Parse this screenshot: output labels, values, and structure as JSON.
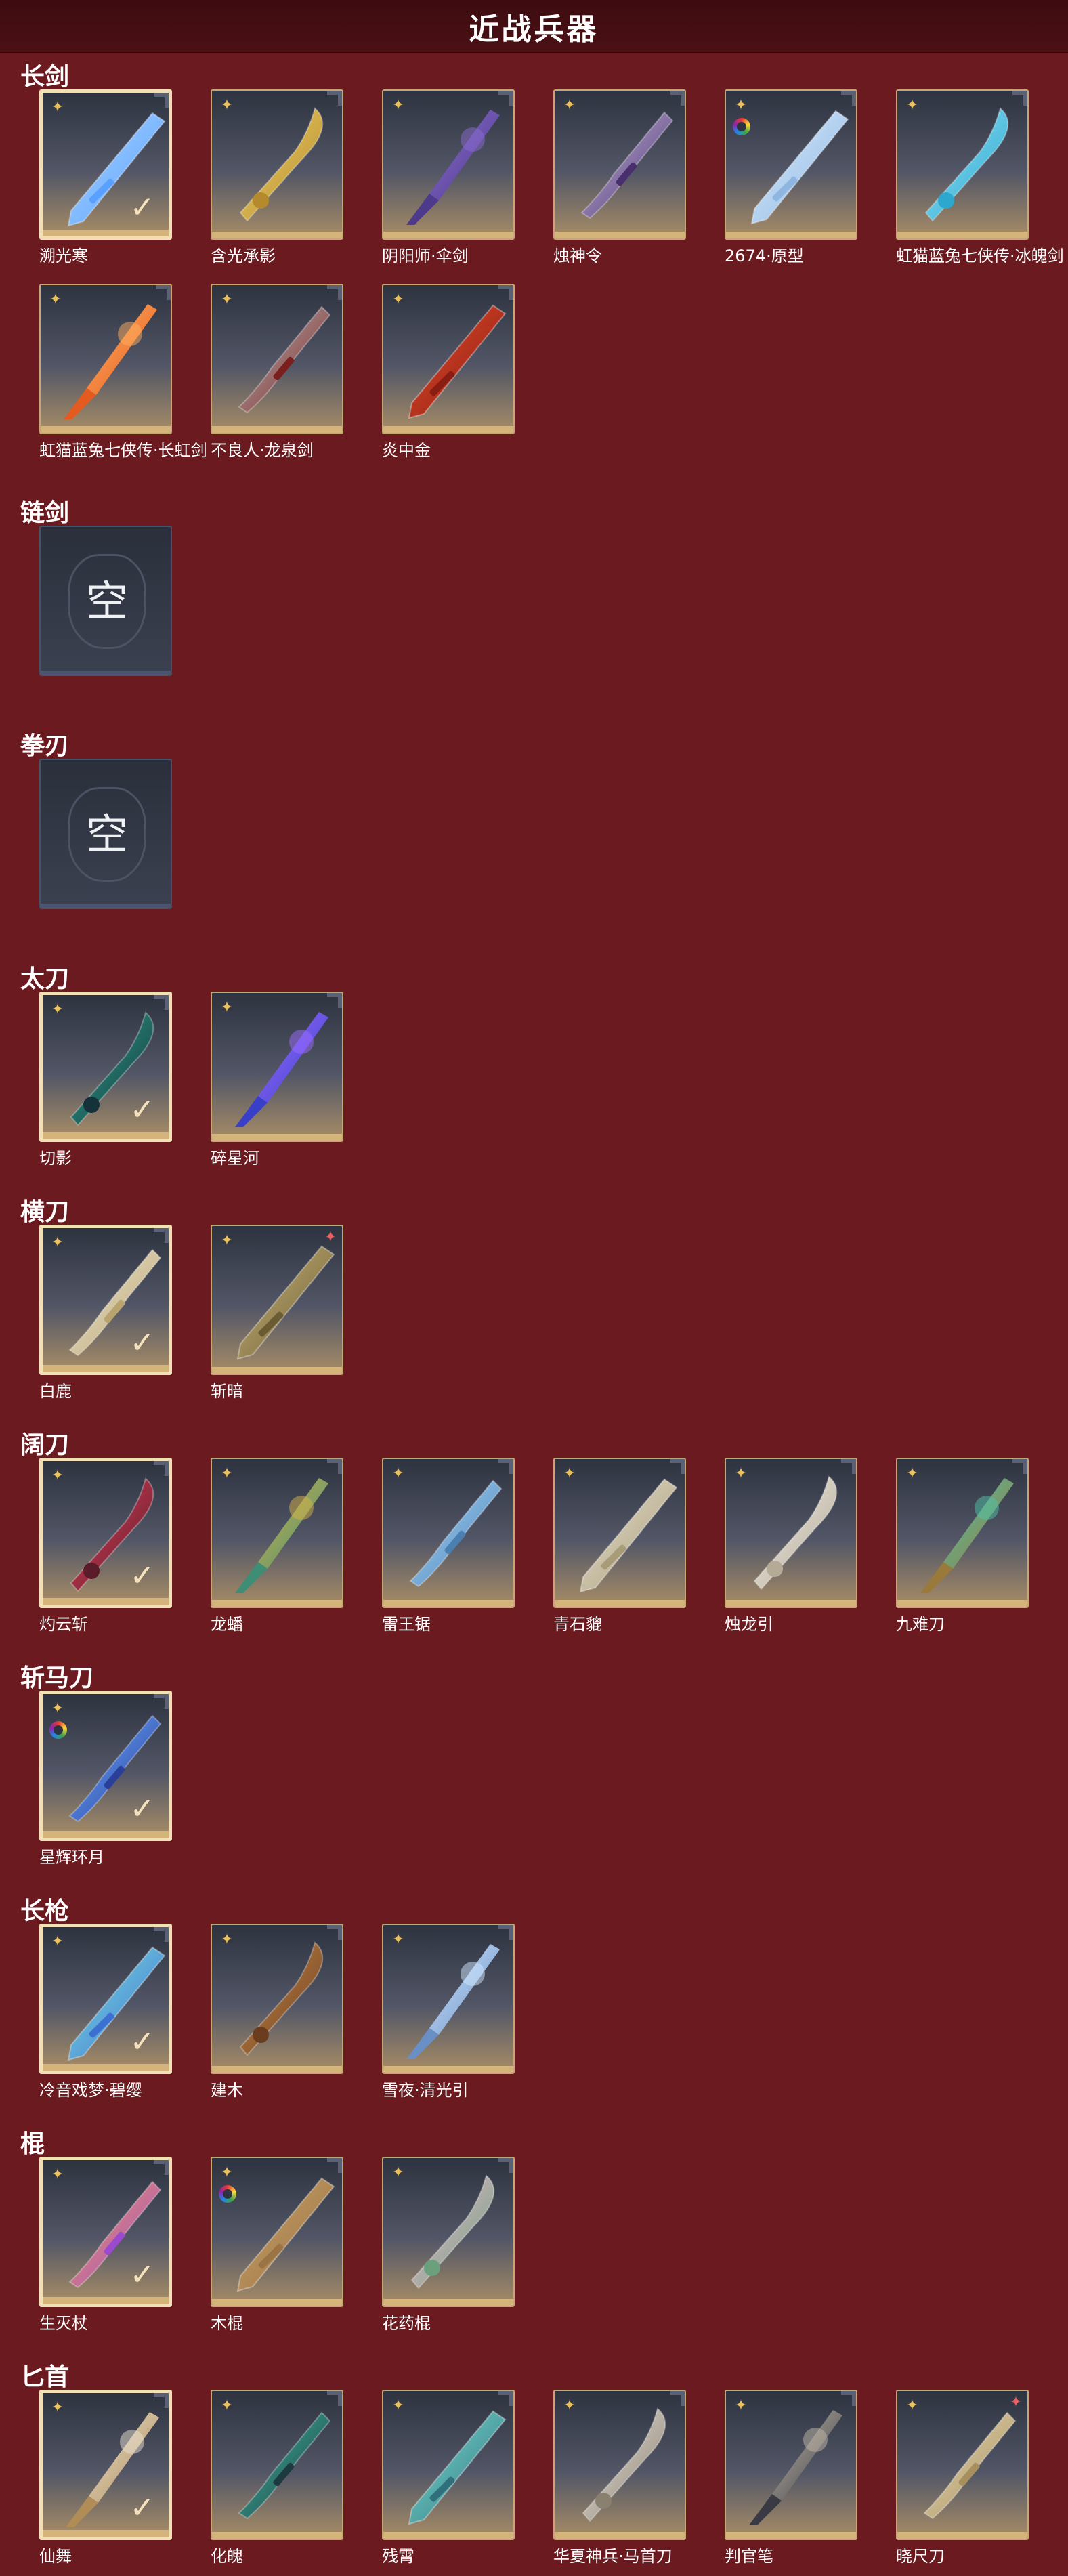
{
  "header": {
    "title": "近战兵器"
  },
  "colors": {
    "background": "#6b1a1f",
    "header": "#3d0c10",
    "tile_border": "#c7a675",
    "selected_border": "#f2dfb6",
    "rank_icon": "#e9c05c"
  },
  "sections": [
    {
      "title": "长剑",
      "items": [
        {
          "name": "溯光寒",
          "selected": true,
          "ring": false,
          "badge": false,
          "colors": [
            "#a8d4ff",
            "#5aa0ff"
          ]
        },
        {
          "name": "含光承影",
          "selected": false,
          "ring": false,
          "badge": false,
          "colors": [
            "#f0d26a",
            "#b48a2c"
          ]
        },
        {
          "name": "阴阳师·伞剑",
          "selected": false,
          "ring": false,
          "badge": false,
          "colors": [
            "#8a6ccf",
            "#4d3a8a"
          ]
        },
        {
          "name": "烛神令",
          "selected": false,
          "ring": false,
          "badge": false,
          "colors": [
            "#c4b8dc",
            "#4a2f6e"
          ]
        },
        {
          "name": "2674·原型",
          "selected": false,
          "ring": true,
          "badge": false,
          "colors": [
            "#d8ecff",
            "#8fb6e0"
          ]
        },
        {
          "name": "虹猫蓝兔七侠传·冰魄剑",
          "selected": false,
          "ring": false,
          "badge": false,
          "colors": [
            "#8fe2f5",
            "#2ea7cf"
          ]
        },
        {
          "name": "虹猫蓝兔七侠传·长虹剑",
          "selected": false,
          "ring": false,
          "badge": false,
          "colors": [
            "#ffb060",
            "#e55a1f"
          ]
        },
        {
          "name": "不良人·龙泉剑",
          "selected": false,
          "ring": false,
          "badge": false,
          "colors": [
            "#b8b8b8",
            "#7a1e1e"
          ]
        },
        {
          "name": "炎中金",
          "selected": false,
          "ring": false,
          "badge": false,
          "colors": [
            "#e24a2a",
            "#8a1d12"
          ]
        }
      ]
    },
    {
      "title": "链剑",
      "empty": true,
      "empty_label": "空",
      "items": []
    },
    {
      "title": "拳刃",
      "empty": true,
      "empty_label": "空",
      "items": []
    },
    {
      "title": "太刀",
      "items": [
        {
          "name": "切影",
          "selected": true,
          "ring": false,
          "badge": false,
          "colors": [
            "#2ea58f",
            "#15323a"
          ]
        },
        {
          "name": "碎星河",
          "selected": false,
          "ring": false,
          "badge": false,
          "colors": [
            "#9b6cff",
            "#3a3fc9"
          ]
        }
      ]
    },
    {
      "title": "横刀",
      "items": [
        {
          "name": "白鹿",
          "selected": true,
          "ring": false,
          "badge": false,
          "colors": [
            "#eee6d2",
            "#b9a46f"
          ]
        },
        {
          "name": "斩暗",
          "selected": false,
          "ring": false,
          "badge": true,
          "colors": [
            "#c9b57a",
            "#6b5b32"
          ]
        }
      ]
    },
    {
      "title": "阔刀",
      "items": [
        {
          "name": "灼云斩",
          "selected": true,
          "ring": false,
          "badge": false,
          "colors": [
            "#e0405a",
            "#5a1b2a"
          ]
        },
        {
          "name": "龙蟠",
          "selected": false,
          "ring": false,
          "badge": false,
          "colors": [
            "#d6b248",
            "#3e8e76"
          ]
        },
        {
          "name": "雷王锯",
          "selected": false,
          "ring": false,
          "badge": false,
          "colors": [
            "#a9d8ff",
            "#4a7fb0"
          ]
        },
        {
          "name": "青石貔",
          "selected": false,
          "ring": false,
          "badge": false,
          "colors": [
            "#e6e0cf",
            "#a89b78"
          ]
        },
        {
          "name": "烛龙引",
          "selected": false,
          "ring": false,
          "badge": false,
          "colors": [
            "#f0ede6",
            "#b4aa96"
          ]
        },
        {
          "name": "九难刀",
          "selected": false,
          "ring": false,
          "badge": false,
          "colors": [
            "#4fc1a8",
            "#9a7a3a"
          ]
        }
      ]
    },
    {
      "title": "斩马刀",
      "items": [
        {
          "name": "星辉环月",
          "selected": true,
          "ring": true,
          "badge": false,
          "colors": [
            "#6aa8ff",
            "#2a3f9a"
          ]
        }
      ]
    },
    {
      "title": "长枪",
      "items": [
        {
          "name": "冷音戏梦·碧缨",
          "selected": true,
          "ring": false,
          "badge": false,
          "colors": [
            "#7ee0e0",
            "#3b6fd1"
          ]
        },
        {
          "name": "建木",
          "selected": false,
          "ring": false,
          "badge": false,
          "colors": [
            "#c78a4a",
            "#6b3d1f"
          ]
        },
        {
          "name": "雪夜·清光引",
          "selected": false,
          "ring": false,
          "badge": false,
          "colors": [
            "#cfe7ff",
            "#6a8fc4"
          ]
        }
      ]
    },
    {
      "title": "棍",
      "items": [
        {
          "name": "生灭杖",
          "selected": true,
          "ring": false,
          "badge": false,
          "colors": [
            "#f29a5a",
            "#9b4ad0"
          ]
        },
        {
          "name": "木棍",
          "selected": false,
          "ring": true,
          "badge": false,
          "colors": [
            "#c8a068",
            "#9a7444"
          ]
        },
        {
          "name": "花药棍",
          "selected": false,
          "ring": false,
          "badge": false,
          "colors": [
            "#f0b8d0",
            "#6aa07e"
          ]
        }
      ]
    },
    {
      "title": "匕首",
      "items": [
        {
          "name": "仙舞",
          "selected": true,
          "ring": false,
          "badge": false,
          "colors": [
            "#e8e0cf",
            "#b08c56"
          ]
        },
        {
          "name": "化魄",
          "selected": false,
          "ring": false,
          "badge": false,
          "colors": [
            "#3fb8a0",
            "#1d3a40"
          ]
        },
        {
          "name": "残霄",
          "selected": false,
          "ring": false,
          "badge": false,
          "colors": [
            "#7ce0d6",
            "#2e6f7a"
          ]
        },
        {
          "name": "华夏神兵·马首刀",
          "selected": false,
          "ring": false,
          "badge": false,
          "colors": [
            "#e8e4dc",
            "#8a8070"
          ]
        },
        {
          "name": "判官笔",
          "selected": false,
          "ring": false,
          "badge": false,
          "colors": [
            "#c0b8a8",
            "#3a3a44"
          ]
        },
        {
          "name": "晓尺刀",
          "selected": false,
          "ring": false,
          "badge": true,
          "colors": [
            "#e6d8b4",
            "#a78f5e"
          ]
        }
      ]
    }
  ]
}
